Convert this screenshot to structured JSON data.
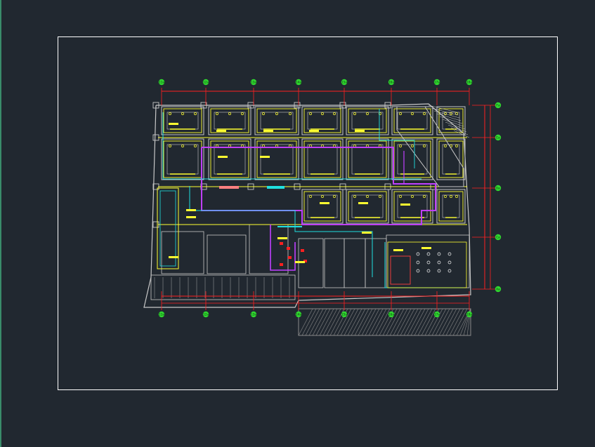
{
  "viewport": {
    "background": "#212830",
    "sheet_border_color": "#ffffff"
  },
  "colors": {
    "wall": "#c8c8c8",
    "hatch": "#8a8a8a",
    "grid_bubble": "#2fd92f",
    "dimension": "#ff2020",
    "cable_tray": "#c040ff",
    "conduit": "#20e0e0",
    "fixture": "#ffff30",
    "label": "#ffff30"
  },
  "drawing": {
    "top_grid_labels": [
      "11a",
      "12a",
      "13a",
      "14a",
      "15a",
      "16a",
      "17a",
      "18a"
    ],
    "bottom_grid_labels": [
      "11a",
      "12a",
      "13a",
      "14a",
      "15a",
      "16a",
      "17a",
      "18a"
    ],
    "right_grid_labels": [
      "Fa",
      "Ea",
      "Da",
      "Ca",
      "Aa"
    ]
  }
}
